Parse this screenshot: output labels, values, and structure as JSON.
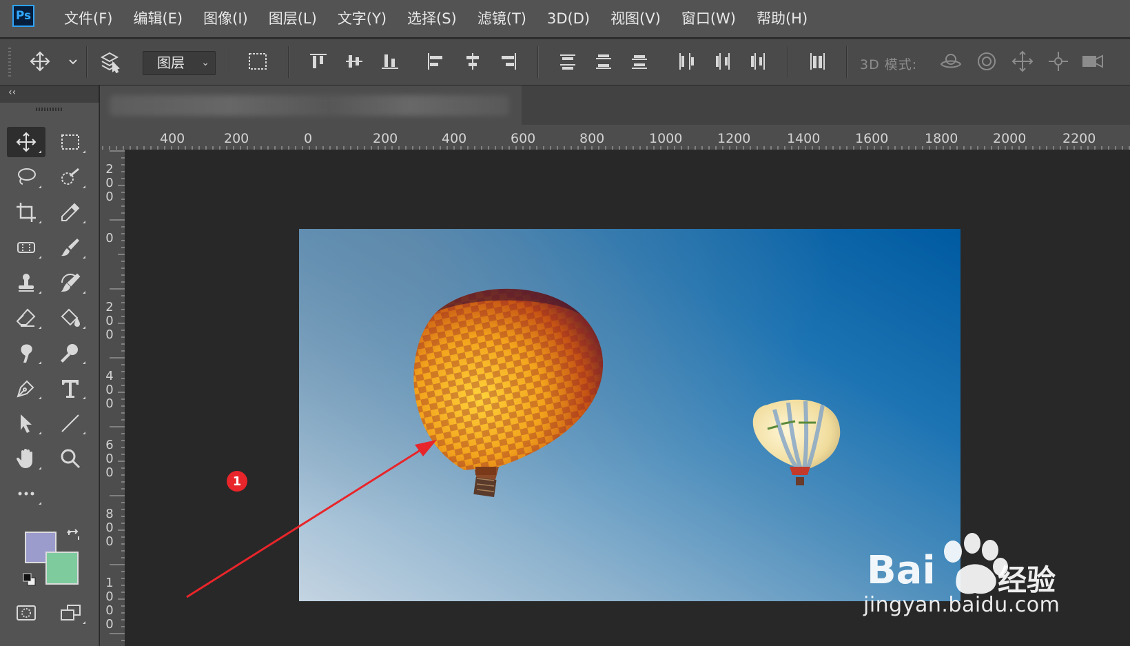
{
  "app": {
    "logo_text": "Ps"
  },
  "menu": [
    {
      "label": "文件(F)"
    },
    {
      "label": "编辑(E)"
    },
    {
      "label": "图像(I)"
    },
    {
      "label": "图层(L)"
    },
    {
      "label": "文字(Y)"
    },
    {
      "label": "选择(S)"
    },
    {
      "label": "滤镜(T)"
    },
    {
      "label": "3D(D)"
    },
    {
      "label": "视图(V)"
    },
    {
      "label": "窗口(W)"
    },
    {
      "label": "帮助(H)"
    }
  ],
  "options_bar": {
    "auto_select_target": "图层",
    "mode_3d_label": "3D 模式:"
  },
  "tools": [
    {
      "name": "move-tool",
      "icon": "move-icon",
      "active": true
    },
    {
      "name": "rectangular-marquee-tool",
      "icon": "marquee-icon"
    },
    {
      "name": "lasso-tool",
      "icon": "lasso-icon"
    },
    {
      "name": "quick-selection-tool",
      "icon": "quick-selection-icon"
    },
    {
      "name": "crop-tool",
      "icon": "crop-icon"
    },
    {
      "name": "eyedropper-tool",
      "icon": "eyedropper-icon"
    },
    {
      "name": "healing-brush-tool",
      "icon": "bandage-icon"
    },
    {
      "name": "brush-tool",
      "icon": "brush-icon"
    },
    {
      "name": "clone-stamp-tool",
      "icon": "stamp-icon"
    },
    {
      "name": "history-brush-tool",
      "icon": "history-brush-icon"
    },
    {
      "name": "eraser-tool",
      "icon": "eraser-icon"
    },
    {
      "name": "paint-bucket-tool",
      "icon": "bucket-icon"
    },
    {
      "name": "smudge-tool",
      "icon": "smudge-icon"
    },
    {
      "name": "dodge-tool",
      "icon": "dodge-icon"
    },
    {
      "name": "pen-tool",
      "icon": "pen-icon"
    },
    {
      "name": "type-tool",
      "icon": "type-icon"
    },
    {
      "name": "path-selection-tool",
      "icon": "arrow-icon"
    },
    {
      "name": "line-tool",
      "icon": "line-icon"
    },
    {
      "name": "hand-tool",
      "icon": "hand-icon"
    },
    {
      "name": "zoom-tool",
      "icon": "zoom-icon"
    }
  ],
  "colors": {
    "foreground": "#9c9ccc",
    "background": "#7ecb9e",
    "annotation": "#e8252a"
  },
  "ruler": {
    "horizontal": [
      "400",
      "200",
      "0",
      "200",
      "400",
      "600",
      "800",
      "1000",
      "1200",
      "1400",
      "1600",
      "1800",
      "2000",
      "2200"
    ],
    "vertical": [
      [
        "2",
        "0",
        "0"
      ],
      [
        "0"
      ],
      [
        "2",
        "0",
        "0"
      ],
      [
        "4",
        "0",
        "0"
      ],
      [
        "6",
        "0",
        "0"
      ],
      [
        "8",
        "0",
        "0"
      ],
      [
        "1",
        "0",
        "0",
        "0"
      ]
    ]
  },
  "annotation": {
    "step": "1"
  },
  "watermark": {
    "brand": "Bai du 经验",
    "logo_text": "Bai",
    "jy": "经验",
    "url": "jingyan.baidu.com"
  }
}
